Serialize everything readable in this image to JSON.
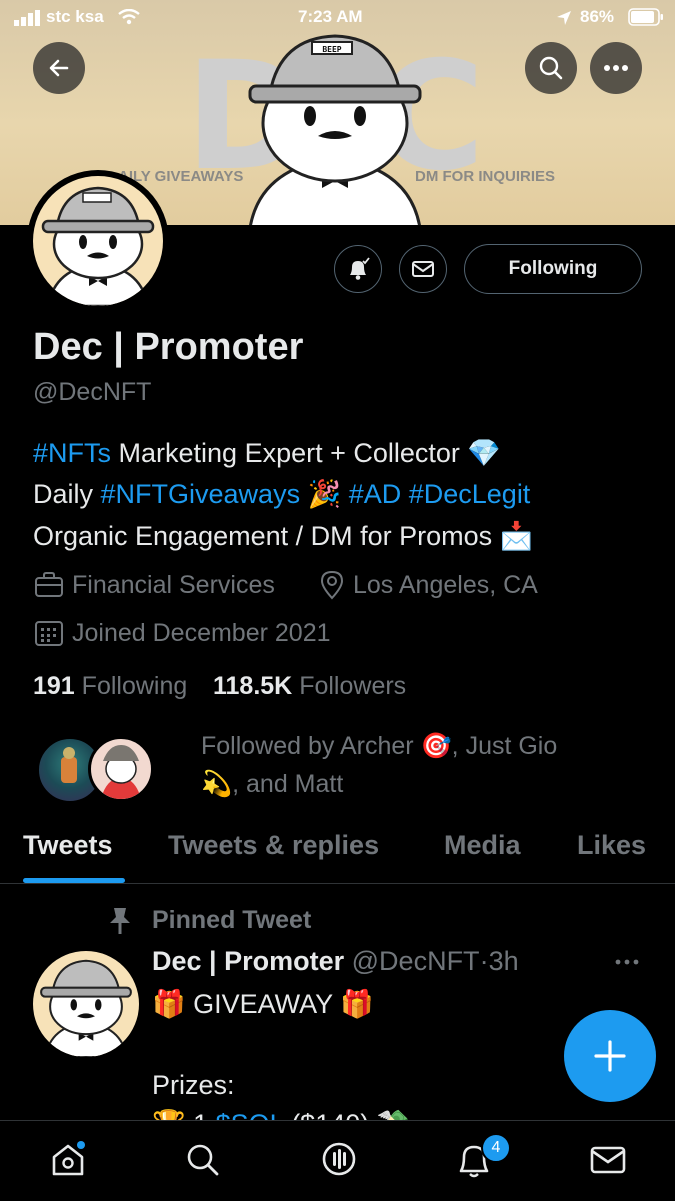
{
  "status_bar": {
    "carrier": "stc ksa",
    "time": "7:23 AM",
    "battery": "86%"
  },
  "banner": {
    "letters": [
      "D",
      "E",
      "C"
    ],
    "left_text": "AILY GIVEAWAYS",
    "right_text": "DM FOR INQUIRIES",
    "hat_label": "BEEP"
  },
  "header_buttons": {
    "back": "back-arrow-icon",
    "search": "search-icon",
    "more": "more-icon"
  },
  "profile": {
    "name": "Dec | Promoter",
    "handle": "@DecNFT",
    "following_button": "Following",
    "bio": {
      "line1_tag": "#NFTs",
      "line1_text": " Marketing Expert + Collector 💎",
      "line2_prefix": "Daily ",
      "line2_tag1": "#NFTGiveaways",
      "line2_mid": " 🎉 ",
      "line2_tag2": "#AD",
      "line2_space": " ",
      "line2_tag3": "#DecLegit",
      "line3_text": "Organic Engagement / DM for Promos 📩"
    },
    "category": "Financial Services",
    "location": "Los Angeles, CA",
    "joined": "Joined December 2021",
    "following_count": "191",
    "following_label": "Following",
    "followers_count": "118.5K",
    "followers_label": "Followers",
    "followed_by_line1": "Followed by Archer 🎯, Just Gio",
    "followed_by_line2": "💫, and Matt"
  },
  "tabs": [
    {
      "label": "Tweets",
      "active": true
    },
    {
      "label": "Tweets & replies",
      "active": false
    },
    {
      "label": "Media",
      "active": false
    },
    {
      "label": "Likes",
      "active": false
    }
  ],
  "pinned_tweet": {
    "pinned_label": "Pinned Tweet",
    "author": "Dec | Promoter",
    "handle": "@DecNFT",
    "separator": "·",
    "time": "3h",
    "line1": "🎁 GIVEAWAY 🎁",
    "line2": "Prizes:",
    "line3_prefix": "🏆 1 ",
    "line3_tag": "$SOL",
    "line3_suffix": " ($140) 💸"
  },
  "bottom_nav": {
    "home": "home-icon",
    "search": "search-icon",
    "spaces": "spaces-icon",
    "notifications": "bell-icon",
    "notifications_badge": "4",
    "messages": "mail-icon"
  },
  "colors": {
    "accent": "#1d9bf0",
    "background": "#000000",
    "muted": "#71767b"
  }
}
